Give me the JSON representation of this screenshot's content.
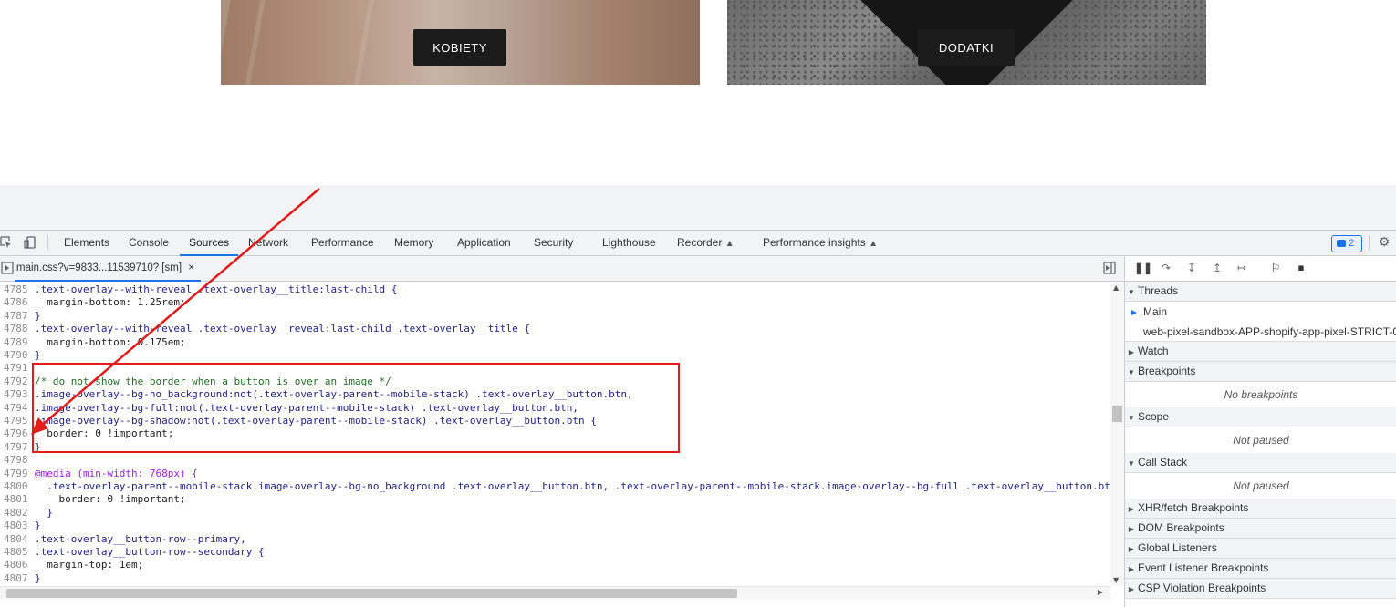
{
  "hero": {
    "left_button": "KOBIETY",
    "right_button": "DODATKI"
  },
  "devtools": {
    "tabs": [
      "Elements",
      "Console",
      "Sources",
      "Network",
      "Performance",
      "Memory",
      "Application",
      "Security",
      "Lighthouse",
      "Recorder",
      "Performance insights"
    ],
    "active_tab": "Sources",
    "issues_badge": "2",
    "file_tab": "main.css?v=9833...11539710? [sm]",
    "file_tab_close": "×",
    "code_lines": [
      {
        "n": "4785",
        "text": ".text-overlay--with-reveal .text-overlay__title:last-child {",
        "kind": "sel"
      },
      {
        "n": "4786",
        "text": "  margin-bottom: 1.25rem;",
        "kind": "prop"
      },
      {
        "n": "4787",
        "text": "}",
        "kind": "sel"
      },
      {
        "n": "4788",
        "text": ".text-overlay--with-reveal .text-overlay__reveal:last-child .text-overlay__title {",
        "kind": "sel"
      },
      {
        "n": "4789",
        "text": "  margin-bottom: 0.175em;",
        "kind": "prop"
      },
      {
        "n": "4790",
        "text": "}",
        "kind": "sel"
      },
      {
        "n": "4791",
        "text": "",
        "kind": "sel"
      },
      {
        "n": "4792",
        "text": "/* do not show the border when a button is over an image */",
        "kind": "comment"
      },
      {
        "n": "4793",
        "text": ".image-overlay--bg-no_background:not(.text-overlay-parent--mobile-stack) .text-overlay__button.btn,",
        "kind": "sel"
      },
      {
        "n": "4794",
        "text": ".image-overlay--bg-full:not(.text-overlay-parent--mobile-stack) .text-overlay__button.btn,",
        "kind": "sel"
      },
      {
        "n": "4795",
        "text": ".image-overlay--bg-shadow:not(.text-overlay-parent--mobile-stack) .text-overlay__button.btn {",
        "kind": "sel"
      },
      {
        "n": "4796",
        "text": "  border: 0 !important;",
        "kind": "prop"
      },
      {
        "n": "4797",
        "text": "}",
        "kind": "sel"
      },
      {
        "n": "4798",
        "text": "",
        "kind": "sel"
      },
      {
        "n": "4799",
        "text": "@media (min-width: 768px) {",
        "kind": "at"
      },
      {
        "n": "4800",
        "text": "  .text-overlay-parent--mobile-stack.image-overlay--bg-no_background .text-overlay__button.btn, .text-overlay-parent--mobile-stack.image-overlay--bg-full .text-overlay__button.bt",
        "kind": "sel"
      },
      {
        "n": "4801",
        "text": "    border: 0 !important;",
        "kind": "prop"
      },
      {
        "n": "4802",
        "text": "  }",
        "kind": "sel"
      },
      {
        "n": "4803",
        "text": "}",
        "kind": "sel"
      },
      {
        "n": "4804",
        "text": ".text-overlay__button-row--primary,",
        "kind": "sel"
      },
      {
        "n": "4805",
        "text": ".text-overlay__button-row--secondary {",
        "kind": "sel"
      },
      {
        "n": "4806",
        "text": "  margin-top: 1em;",
        "kind": "prop"
      },
      {
        "n": "4807",
        "text": "}",
        "kind": "sel"
      }
    ]
  },
  "debugger": {
    "threads_label": "Threads",
    "thread_main": "Main",
    "thread_other": "web-pixel-sandbox-APP-shopify-app-pixel-STRICT-0",
    "watch_label": "Watch",
    "breakpoints_label": "Breakpoints",
    "no_breakpoints": "No breakpoints",
    "scope_label": "Scope",
    "scope_status": "Not paused",
    "callstack_label": "Call Stack",
    "callstack_status": "Not paused",
    "xhr_label": "XHR/fetch Breakpoints",
    "dom_label": "DOM Breakpoints",
    "global_label": "Global Listeners",
    "event_label": "Event Listener Breakpoints",
    "csp_label": "CSP Violation Breakpoints"
  }
}
